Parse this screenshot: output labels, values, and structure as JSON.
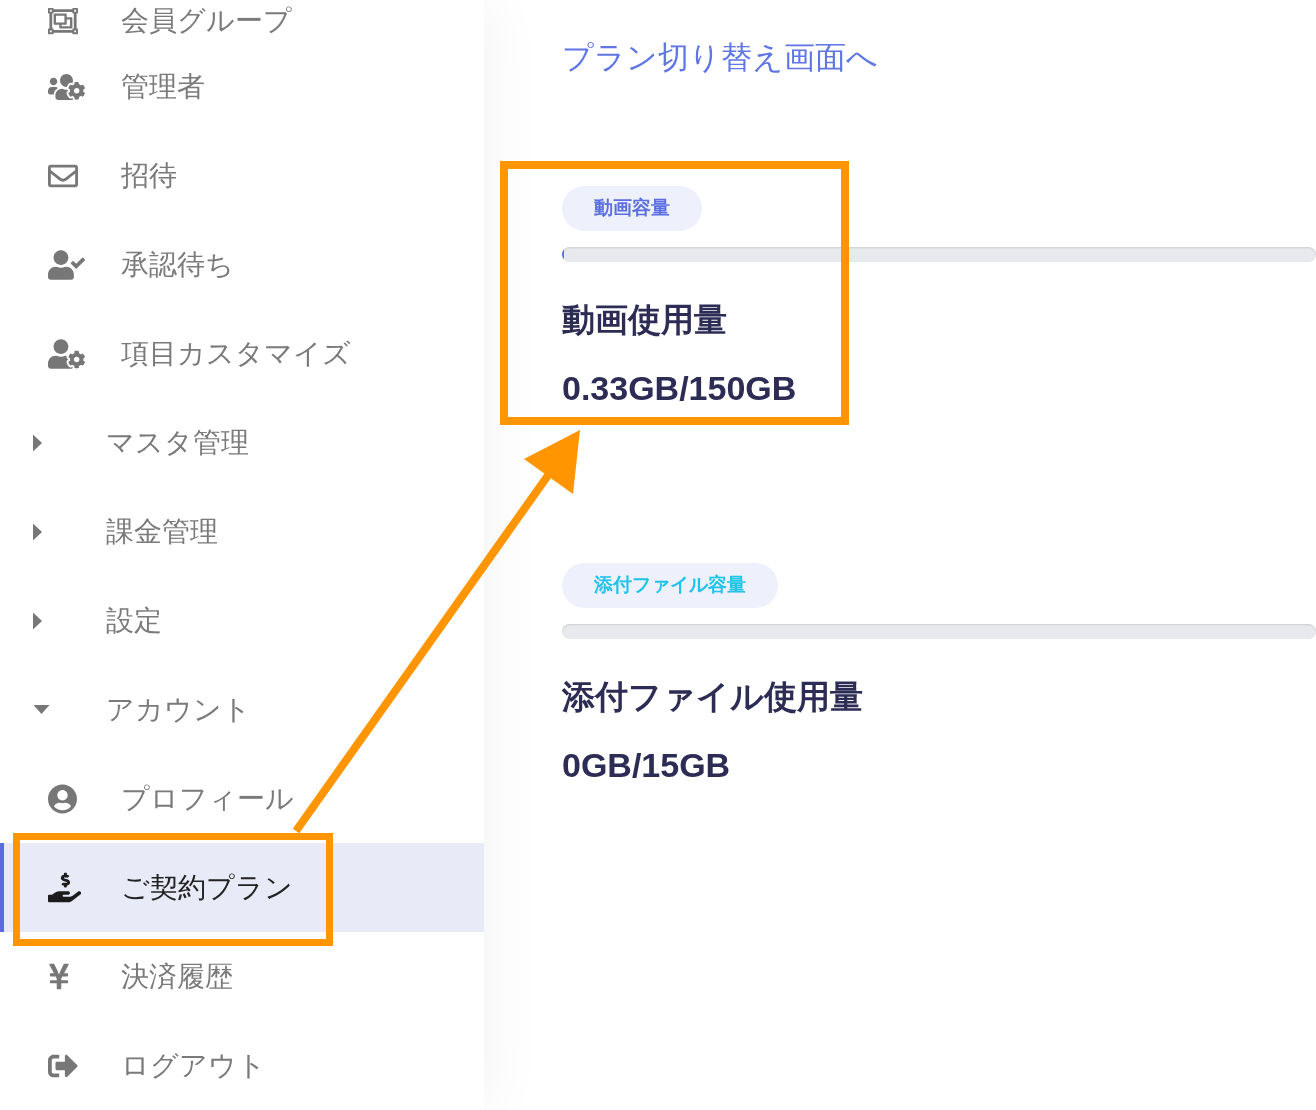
{
  "sidebar": {
    "items": [
      {
        "kind": "link",
        "label": "会員グループ",
        "selected": false
      },
      {
        "kind": "link",
        "label": "管理者",
        "selected": false
      },
      {
        "kind": "link",
        "label": "招待",
        "selected": false
      },
      {
        "kind": "link",
        "label": "承認待ち",
        "selected": false
      },
      {
        "kind": "link",
        "label": "項目カスタマイズ",
        "selected": false
      },
      {
        "kind": "group",
        "label": "マスタ管理",
        "expanded": false
      },
      {
        "kind": "group",
        "label": "課金管理",
        "expanded": false
      },
      {
        "kind": "group",
        "label": "設定",
        "expanded": false
      },
      {
        "kind": "group",
        "label": "アカウント",
        "expanded": true,
        "children": [
          {
            "kind": "link",
            "label": "プロフィール",
            "selected": false
          },
          {
            "kind": "link",
            "label": "ご契約プラン",
            "selected": true
          },
          {
            "kind": "link",
            "label": "決済履歴",
            "selected": false
          },
          {
            "kind": "link",
            "label": "ログアウト",
            "selected": false
          }
        ]
      }
    ]
  },
  "main": {
    "plan_link": "プラン切り替え画面へ",
    "sections": [
      {
        "tag": "動画容量",
        "color": "#5b6fe0",
        "level": 0.0022,
        "heading": "動画使用量",
        "usage": "0.33GB/150GB"
      },
      {
        "tag": "添付ファイル容量",
        "color": "#1ec3ea",
        "heading": "添付ファイル使用量",
        "usage": "0GB/15GB"
      }
    ]
  }
}
